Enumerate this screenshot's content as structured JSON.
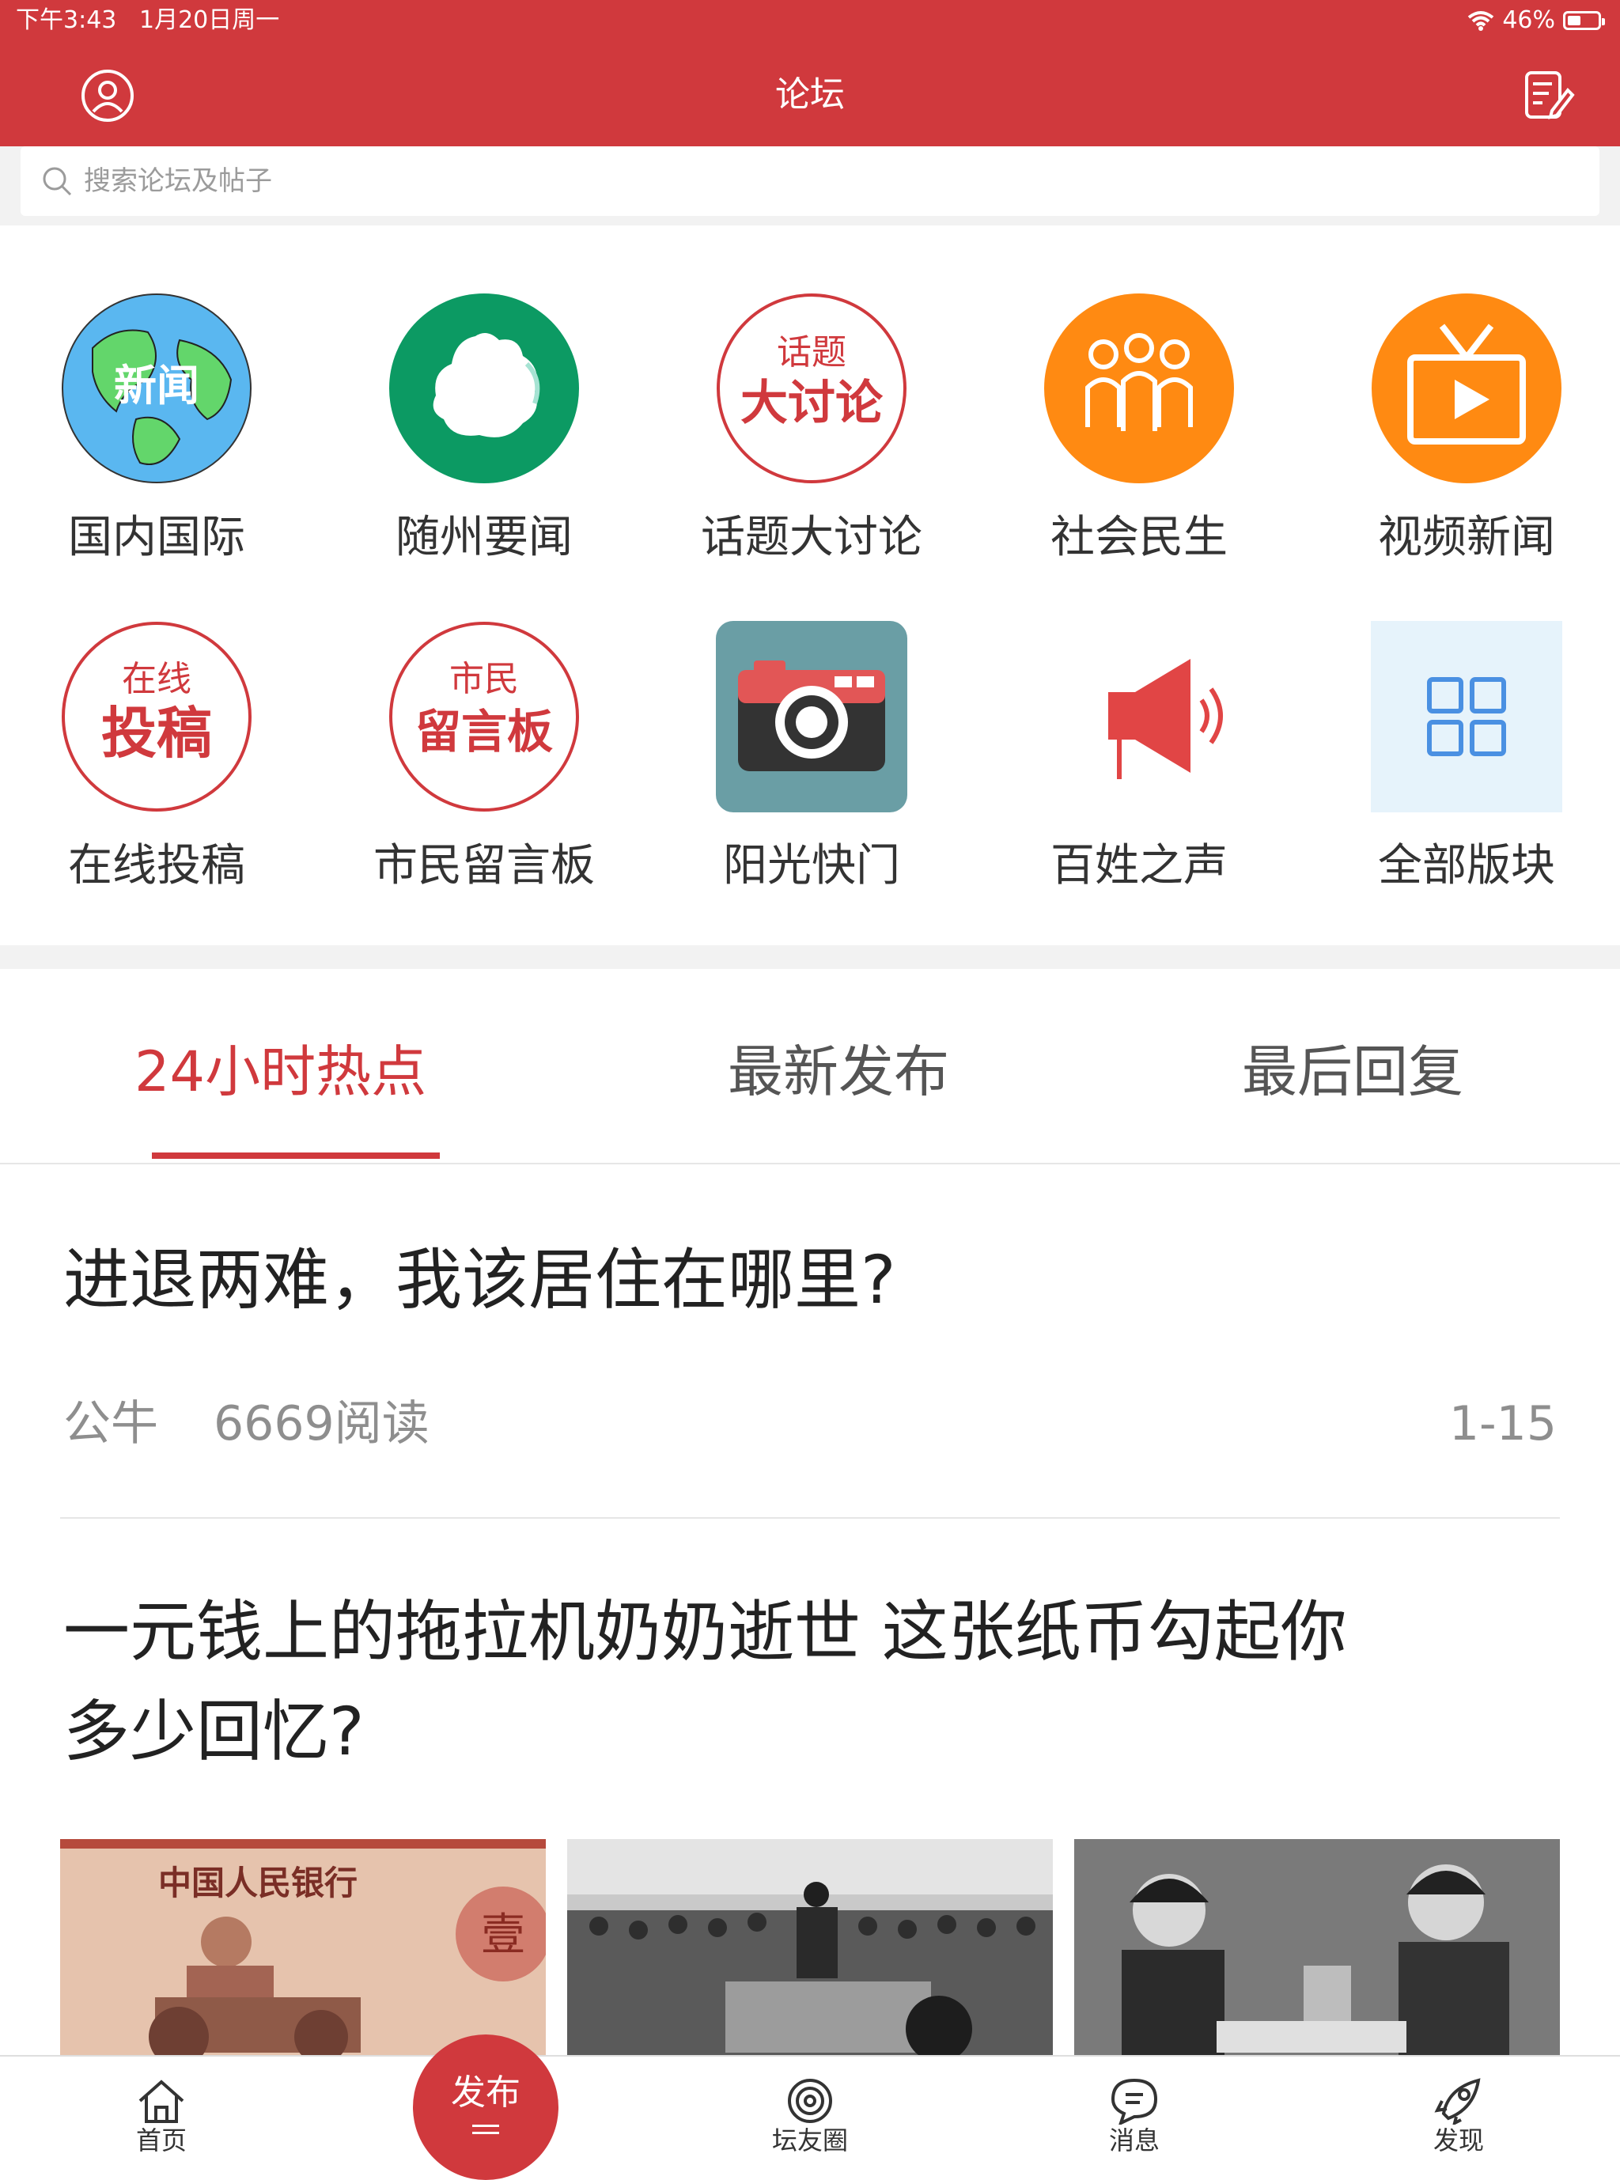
{
  "status_bar": {
    "time": "下午3:43",
    "date": "1月20日周一",
    "battery": "46%"
  },
  "header": {
    "title": "论坛"
  },
  "search": {
    "placeholder": "搜索论坛及帖子"
  },
  "categories": [
    {
      "label": "国内国际",
      "icon": "globe-news-icon",
      "badge": "新闻"
    },
    {
      "label": "随州要闻",
      "icon": "suizhou-map-icon"
    },
    {
      "label": "话题大讨论",
      "icon": "topic-discussion-stamp-icon",
      "stamp_top": "话题",
      "stamp_main": "大讨论"
    },
    {
      "label": "社会民生",
      "icon": "people-icon"
    },
    {
      "label": "视频新闻",
      "icon": "tv-play-icon"
    },
    {
      "label": "在线投稿",
      "icon": "online-submission-stamp-icon",
      "stamp_top": "在线",
      "stamp_main": "投稿"
    },
    {
      "label": "市民留言板",
      "icon": "message-board-stamp-icon",
      "stamp_top": "市民",
      "stamp_main": "留言板"
    },
    {
      "label": "阳光快门",
      "icon": "camera-icon"
    },
    {
      "label": "百姓之声",
      "icon": "megaphone-icon"
    },
    {
      "label": "全部版块",
      "icon": "grid-icon"
    }
  ],
  "tabs": [
    {
      "label": "24小时热点",
      "active": true
    },
    {
      "label": "最新发布",
      "active": false
    },
    {
      "label": "最后回复",
      "active": false
    }
  ],
  "posts": [
    {
      "title": "进退两难，我该居住在哪里?",
      "author": "公牛",
      "reads": "6669阅读",
      "date": "1-15"
    },
    {
      "title_line1": "一元钱上的拖拉机奶奶逝世 这张纸币勾起你",
      "title_line2": "多少回忆?",
      "thumb1_text": "中国人民银行",
      "thumb1_corner": "壹"
    }
  ],
  "bottom_nav": {
    "home": "首页",
    "publish": "发布",
    "circle": "坛友圈",
    "messages": "消息",
    "discover": "发现"
  },
  "colors": {
    "brand": "#d0393d",
    "green": "#0c9a63",
    "orange": "#ff8a12",
    "teal": "#6a9ea5",
    "blue": "#4a90e2"
  }
}
